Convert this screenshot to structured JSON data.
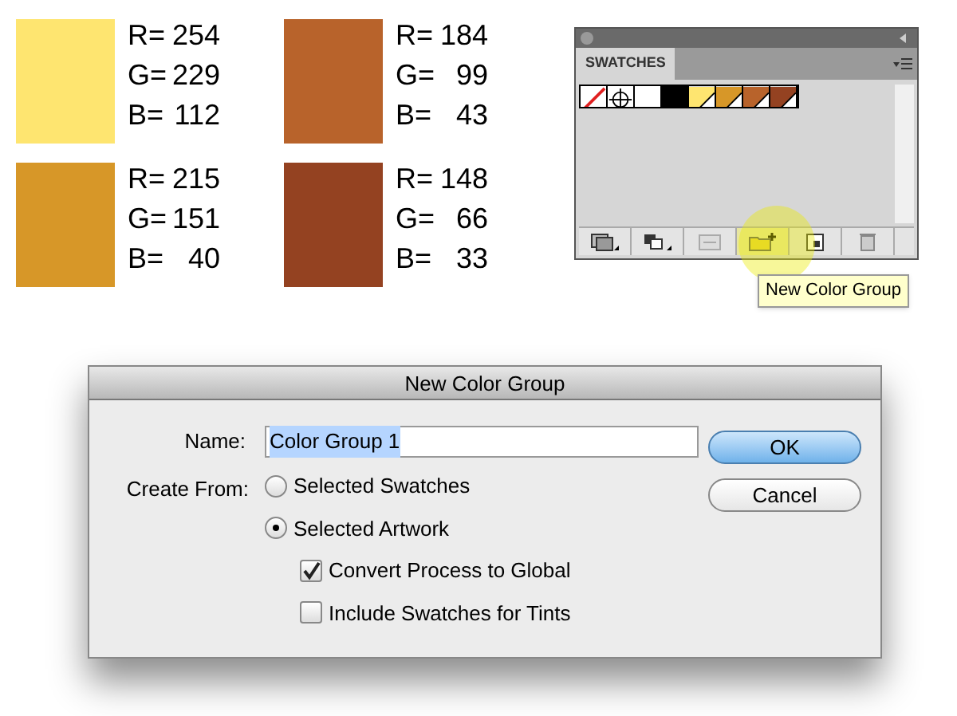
{
  "color_samples": [
    {
      "color": "#fee570",
      "channels": [
        {
          "label": "R=",
          "value": "254"
        },
        {
          "label": "G=",
          "value": "229"
        },
        {
          "label": "B=",
          "value": "112"
        }
      ]
    },
    {
      "color": "#b8632b",
      "channels": [
        {
          "label": "R=",
          "value": "184"
        },
        {
          "label": "G=",
          "value": "99"
        },
        {
          "label": "B=",
          "value": "43"
        }
      ]
    },
    {
      "color": "#d79728",
      "channels": [
        {
          "label": "R=",
          "value": "215"
        },
        {
          "label": "G=",
          "value": "151"
        },
        {
          "label": "B=",
          "value": "40"
        }
      ]
    },
    {
      "color": "#944221",
      "channels": [
        {
          "label": "R=",
          "value": "148"
        },
        {
          "label": "G=",
          "value": "66"
        },
        {
          "label": "B=",
          "value": "33"
        }
      ]
    }
  ],
  "swatches_panel": {
    "tab": "SWATCHES",
    "swatches": [
      {
        "kind": "none"
      },
      {
        "kind": "registration"
      },
      {
        "kind": "solid",
        "color": "#ffffff"
      },
      {
        "kind": "solid",
        "color": "#000000"
      },
      {
        "kind": "global",
        "color": "#fee570"
      },
      {
        "kind": "global",
        "color": "#d79728"
      },
      {
        "kind": "global",
        "color": "#b8632b"
      },
      {
        "kind": "global",
        "color": "#944221"
      }
    ],
    "toolbar": [
      {
        "kind": "library",
        "highlighted": false
      },
      {
        "kind": "kinds",
        "highlighted": false
      },
      {
        "kind": "options",
        "highlighted": false
      },
      {
        "kind": "new-group",
        "highlighted": true
      },
      {
        "kind": "new-swatch",
        "highlighted": false
      },
      {
        "kind": "delete",
        "highlighted": false
      }
    ],
    "tooltip": "New Color Group"
  },
  "dialog": {
    "title": "New Color Group",
    "name_label": "Name:",
    "name_value": "Color Group 1",
    "name_selected": true,
    "create_from_label": "Create From:",
    "radios": [
      {
        "label": "Selected Swatches",
        "selected": false
      },
      {
        "label": "Selected Artwork",
        "selected": true
      }
    ],
    "checkboxes": [
      {
        "label": "Convert Process to Global",
        "checked": true
      },
      {
        "label": "Include Swatches for Tints",
        "checked": false
      }
    ],
    "buttons": [
      {
        "label": "OK",
        "default": true
      },
      {
        "label": "Cancel",
        "default": false
      }
    ]
  }
}
